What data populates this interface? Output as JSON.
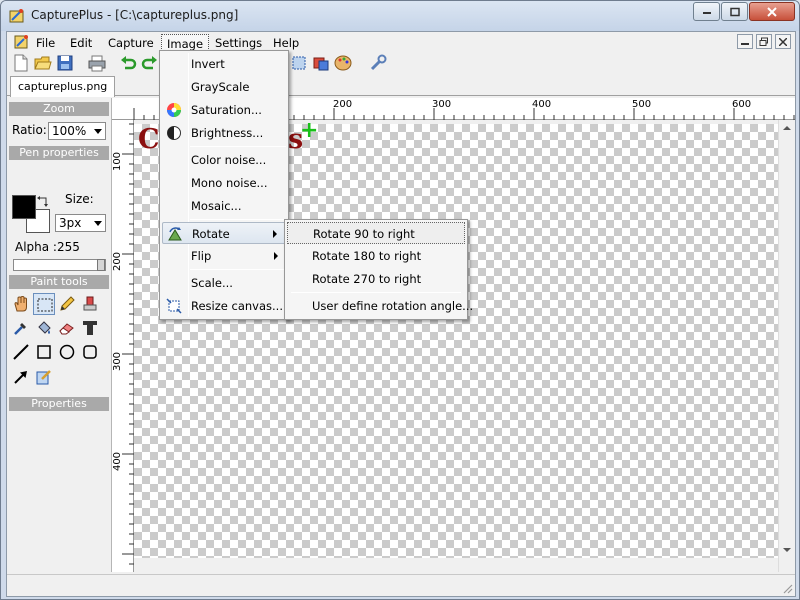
{
  "window": {
    "title": "CapturePlus - [C:\\captureplus.png]"
  },
  "menubar": {
    "items": [
      "File",
      "Edit",
      "Capture",
      "Image",
      "Settings",
      "Help"
    ]
  },
  "tabs": [
    "captureplus.png"
  ],
  "left_panel": {
    "zoom_header": "Zoom",
    "ratio_label": "Ratio:",
    "ratio_value": "100%",
    "pen_header": "Pen properties",
    "size_label": "Size:",
    "size_value": "3px",
    "alpha_label": "Alpha :255",
    "alpha_level": 1.0,
    "paint_tools_header": "Paint tools",
    "properties_header": "Properties",
    "colors": {
      "foreground": "#000000",
      "background": "#ffffff"
    }
  },
  "ruler": {
    "top_labels": [
      "200",
      "300",
      "400",
      "500",
      "600"
    ],
    "left_labels": [
      "100",
      "200",
      "300",
      "400"
    ]
  },
  "canvas": {
    "logo_text_left": "Ca",
    "logo_text_right": "s",
    "logo_plus": "+"
  },
  "image_menu": {
    "items": [
      {
        "label": "Invert",
        "icon": ""
      },
      {
        "label": "GrayScale",
        "icon": ""
      },
      {
        "label": "Saturation...",
        "icon": "color-wheel-icon"
      },
      {
        "label": "Brightness...",
        "icon": "contrast-icon"
      },
      {
        "label": "Color noise...",
        "icon": ""
      },
      {
        "label": "Mono noise...",
        "icon": ""
      },
      {
        "label": "Mosaic...",
        "icon": ""
      },
      {
        "label": "Rotate",
        "icon": "rotate-icon"
      },
      {
        "label": "Flip",
        "icon": ""
      },
      {
        "label": "Scale...",
        "icon": ""
      },
      {
        "label": "Resize canvas...",
        "icon": "resize-canvas-icon"
      }
    ]
  },
  "rotate_submenu": {
    "items": [
      "Rotate 90 to right",
      "Rotate 180 to right",
      "Rotate 270 to right",
      "User define rotation angle..."
    ]
  }
}
